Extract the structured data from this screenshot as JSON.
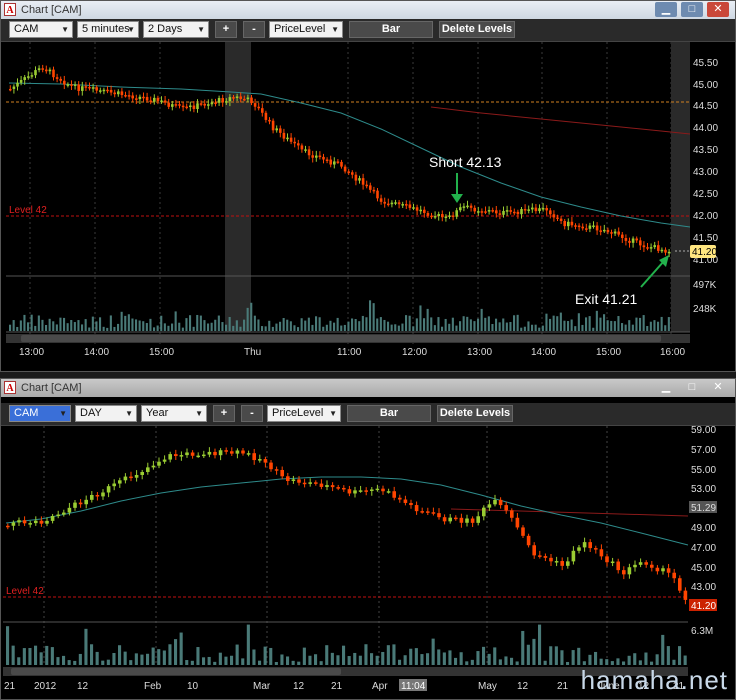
{
  "top_window": {
    "title": "Chart [CAM]",
    "toolbar": {
      "symbol": "CAM",
      "interval": "5 minutes",
      "range": "2 Days",
      "zoom_in": "+",
      "zoom_out": "-",
      "study": "PriceLevel",
      "chart_type": "Bar",
      "delete_levels": "Delete Levels"
    },
    "price_axis": [
      "45.50",
      "45.00",
      "44.50",
      "44.00",
      "43.50",
      "43.00",
      "42.50",
      "42.00",
      "41.50",
      "41.00"
    ],
    "volume_axis": [
      "497K",
      "248K"
    ],
    "last_price": "41.20",
    "level_label": "Level 42",
    "annotations": {
      "short": "Short 42.13",
      "exit": "Exit 41.21"
    },
    "time_axis": [
      "13:00",
      "14:00",
      "15:00",
      "Thu",
      "11:00",
      "12:00",
      "13:00",
      "14:00",
      "15:00",
      "16:00"
    ]
  },
  "bottom_window": {
    "title": "Chart [CAM]",
    "toolbar": {
      "symbol": "CAM",
      "interval": "DAY",
      "range": "Year",
      "zoom_in": "+",
      "zoom_out": "-",
      "study": "PriceLevel",
      "chart_type": "Bar",
      "delete_levels": "Delete Levels"
    },
    "price_axis": [
      "59.00",
      "57.00",
      "55.00",
      "53.00",
      "51.29",
      "49.00",
      "47.00",
      "45.00",
      "43.00",
      "41.20"
    ],
    "volume_axis": [
      "6.3M"
    ],
    "level_label": "Level 42",
    "cursor_time": "11:04",
    "time_axis": [
      "21",
      "2012",
      "12",
      "Feb",
      "10",
      "Mar",
      "12",
      "21",
      "Apr",
      "May",
      "12",
      "21",
      "June",
      "12",
      "21"
    ]
  },
  "watermark": "hamaha.net",
  "colors": {
    "up": "#9acd32",
    "down": "#ff4500",
    "level": "#d01010",
    "ma": "#2e8b8b"
  }
}
